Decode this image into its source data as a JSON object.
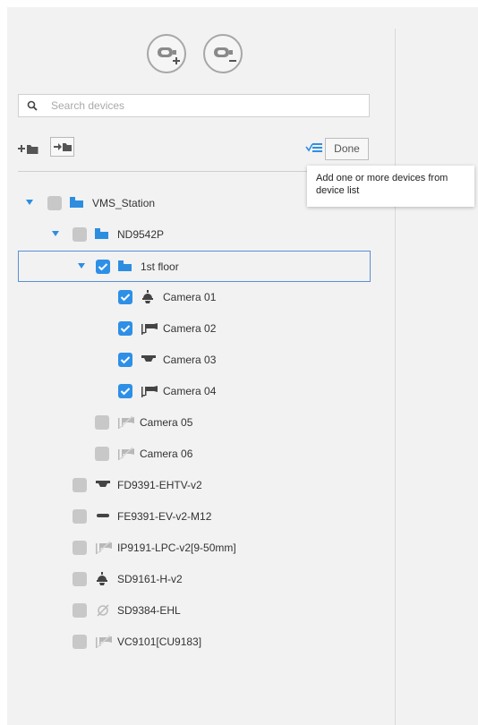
{
  "toolbar": {
    "add_device_button": "add-device",
    "remove_device_button": "remove-device",
    "done_label": "Done"
  },
  "search": {
    "placeholder": "Search devices",
    "value": ""
  },
  "tooltip": {
    "text": "Add one or more devices from device list"
  },
  "tree": [
    {
      "label": "VMS_Station",
      "level": 0,
      "type": "folder",
      "expanded": true,
      "checked": false
    },
    {
      "label": "ND9542P",
      "level": 1,
      "type": "folder",
      "expanded": true,
      "checked": false
    },
    {
      "label": "1st floor",
      "level": 2,
      "type": "folder",
      "expanded": true,
      "checked": true,
      "selected": true
    },
    {
      "label": "Camera 01",
      "level": 3,
      "type": "speed-dome",
      "checked": true
    },
    {
      "label": "Camera 02",
      "level": 3,
      "type": "bullet",
      "checked": true
    },
    {
      "label": "Camera 03",
      "level": 3,
      "type": "dome",
      "checked": true
    },
    {
      "label": "Camera 04",
      "level": 3,
      "type": "bullet",
      "checked": true
    },
    {
      "label": "Camera 05",
      "level": 2,
      "type": "bullet-offline",
      "checked": false
    },
    {
      "label": "Camera 06",
      "level": 2,
      "type": "bullet-offline",
      "checked": false
    },
    {
      "label": "FD9391-EHTV-v2",
      "level": 1,
      "type": "dome",
      "checked": false
    },
    {
      "label": "FE9391-EV-v2-M12",
      "level": 1,
      "type": "fisheye",
      "checked": false
    },
    {
      "label": "IP9191-LPC-v2[9-50mm]",
      "level": 1,
      "type": "bullet-offline",
      "checked": false
    },
    {
      "label": "SD9161-H-v2",
      "level": 1,
      "type": "speed-dome",
      "checked": false
    },
    {
      "label": "SD9384-EHL",
      "level": 1,
      "type": "disabled",
      "checked": false
    },
    {
      "label": "VC9101[CU9183]",
      "level": 1,
      "type": "bullet-offline",
      "checked": false
    }
  ],
  "colors": {
    "accent": "#2e8fe6",
    "checkbox_off": "#c8c8c8",
    "folder": "#2d8ee0",
    "icon_dark": "#444444",
    "icon_gray": "#b0b0b0"
  }
}
